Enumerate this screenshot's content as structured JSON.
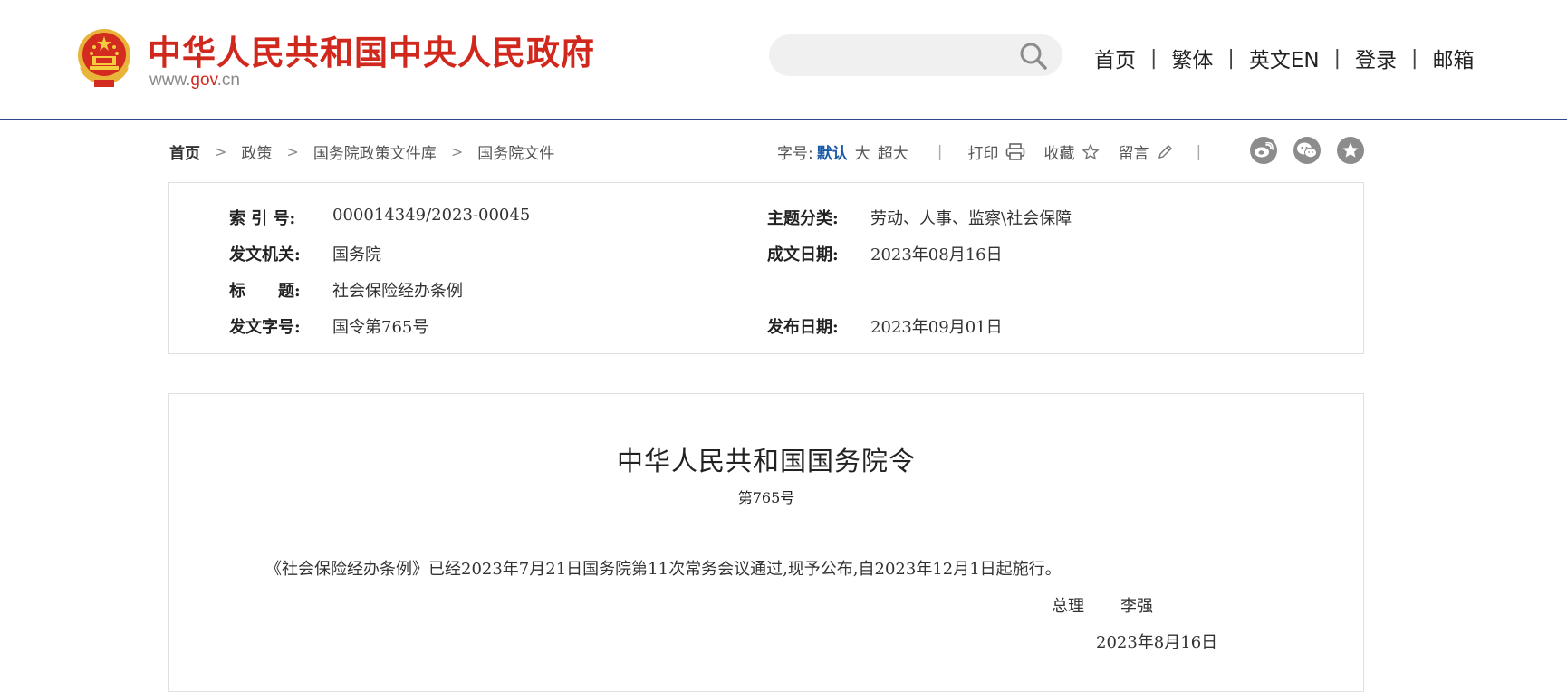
{
  "header": {
    "site_title": "中华人民共和国中央人民政府",
    "domain_prefix": "www.",
    "domain_gov": "gov",
    "domain_suffix": ".cn",
    "search": {
      "placeholder": "",
      "value": ""
    },
    "nav": [
      "首页",
      "繁体",
      "英文EN",
      "登录",
      "邮箱"
    ],
    "nav_separator": "|"
  },
  "breadcrumb": {
    "items": [
      "首页",
      "政策",
      "国务院政策文件库",
      "国务院文件"
    ],
    "separator": ">"
  },
  "tools": {
    "font_size_label": "字号:",
    "font_sizes": [
      "默认",
      "大",
      "超大"
    ],
    "active_font_size": "默认",
    "divider": "|",
    "print_label": "打印",
    "favorite_label": "收藏",
    "comment_label": "留言"
  },
  "share_icons": [
    "weibo-icon",
    "wechat-icon",
    "favorite-star-icon"
  ],
  "meta": {
    "index_no": {
      "label": "索 引 号:",
      "value": "000014349/2023-00045"
    },
    "topic": {
      "label": "主题分类:",
      "value": "劳动、人事、监察\\社会保障"
    },
    "issuer": {
      "label": "发文机关:",
      "value": "国务院"
    },
    "written_date": {
      "label": "成文日期:",
      "value": "2023年08月16日"
    },
    "title": {
      "label": "标　　题:",
      "value": "社会保险经办条例"
    },
    "doc_no": {
      "label": "发文字号:",
      "value": "国令第765号"
    },
    "publish_date": {
      "label": "发布日期:",
      "value": "2023年09月01日"
    }
  },
  "document": {
    "heading": "中华人民共和国国务院令",
    "number": "第765号",
    "body": "《社会保险经办条例》已经2023年7月21日国务院第11次常务会议通过,现予公布,自2023年12月1日起施行。",
    "signer_title": "总理",
    "signer_name": "李强",
    "sign_date": "2023年8月16日"
  },
  "colors": {
    "brand_red": "#d1281e",
    "header_rule": "#2b4c8a",
    "active_link": "#1c5aa8",
    "share_icon_bg": "#8c8c8c"
  }
}
